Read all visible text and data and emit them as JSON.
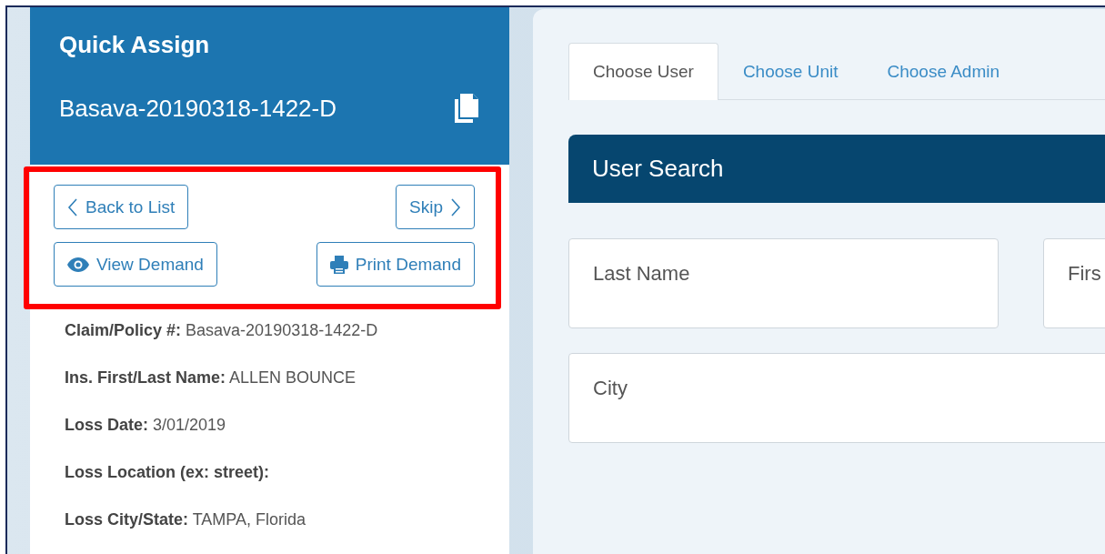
{
  "card": {
    "title": "Quick Assign",
    "claim_number": "Basava-20190318-1422-D",
    "actions_highlighted": true,
    "actions": [
      {
        "label": "Back to List",
        "kind": "back"
      },
      {
        "label": "Skip",
        "kind": "next"
      },
      {
        "label": "View Demand",
        "kind": "view"
      },
      {
        "label": "Print Demand",
        "kind": "print"
      }
    ],
    "details": [
      {
        "label": "Claim/Policy #:",
        "value": "Basava-20190318-1422-D"
      },
      {
        "label": "Ins. First/Last Name:",
        "value": "ALLEN BOUNCE"
      },
      {
        "label": "Loss Date:",
        "value": "3/01/2019"
      },
      {
        "label": "Loss Location (ex: street):"
      },
      {
        "label": "Loss City/State:",
        "value": "TAMPA, Florida"
      }
    ]
  },
  "tabs": [
    {
      "label": "Choose User",
      "selected": true
    },
    {
      "label": "Choose Unit",
      "selected": false
    },
    {
      "label": "Choose Admin",
      "selected": false
    }
  ],
  "section": {
    "title": "User Search"
  },
  "fields": [
    {
      "placeholder": "Last Name"
    },
    {
      "placeholder": "Firs"
    },
    {
      "placeholder": "City"
    }
  ]
}
